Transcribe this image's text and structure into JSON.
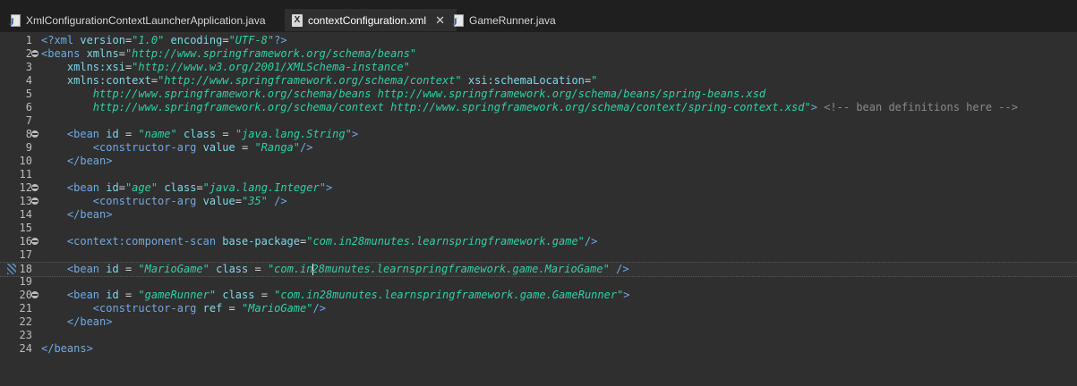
{
  "tabs": [
    {
      "label": "XmlConfigurationContextLauncherApplication.java",
      "icon": "java-file-icon",
      "active": false
    },
    {
      "label": "contextConfiguration.xml",
      "icon": "xml-file-icon",
      "active": true
    },
    {
      "label": "GameRunner.java",
      "icon": "java-file-icon",
      "active": false
    }
  ],
  "editor": {
    "line_numbers": [
      "1",
      "2",
      "3",
      "4",
      "5",
      "6",
      "7",
      "8",
      "9",
      "10",
      "11",
      "12",
      "13",
      "14",
      "15",
      "16",
      "17",
      "18",
      "19",
      "20",
      "21",
      "22",
      "23",
      "24"
    ],
    "lines": [
      {
        "parts": [
          {
            "t": "pi",
            "v": "<?xml "
          },
          {
            "t": "attr",
            "v": "version"
          },
          {
            "t": "plain",
            "v": "="
          },
          {
            "t": "val",
            "v": "\"1.0\""
          },
          {
            "t": "plain",
            "v": " "
          },
          {
            "t": "attr",
            "v": "encoding"
          },
          {
            "t": "plain",
            "v": "="
          },
          {
            "t": "val",
            "v": "\"UTF-8\""
          },
          {
            "t": "pi",
            "v": "?>"
          }
        ]
      },
      {
        "parts": [
          {
            "t": "tag",
            "v": "<beans "
          },
          {
            "t": "attr",
            "v": "xmlns"
          },
          {
            "t": "plain",
            "v": "="
          },
          {
            "t": "val",
            "v": "\"http://www.springframework.org/schema/beans\""
          }
        ]
      },
      {
        "parts": [
          {
            "t": "plain",
            "v": "    "
          },
          {
            "t": "attr",
            "v": "xmlns:xsi"
          },
          {
            "t": "plain",
            "v": "="
          },
          {
            "t": "val",
            "v": "\"http://www.w3.org/2001/XMLSchema-instance\""
          }
        ]
      },
      {
        "parts": [
          {
            "t": "plain",
            "v": "    "
          },
          {
            "t": "attr",
            "v": "xmlns:context"
          },
          {
            "t": "plain",
            "v": "="
          },
          {
            "t": "val",
            "v": "\"http://www.springframework.org/schema/context\""
          },
          {
            "t": "plain",
            "v": " "
          },
          {
            "t": "attr",
            "v": "xsi:schemaLocation"
          },
          {
            "t": "plain",
            "v": "="
          },
          {
            "t": "val",
            "v": "\""
          }
        ]
      },
      {
        "parts": [
          {
            "t": "val",
            "v": "        http://www.springframework.org/schema/beans http://www.springframework.org/schema/beans/spring-beans.xsd"
          }
        ]
      },
      {
        "parts": [
          {
            "t": "val",
            "v": "        http://www.springframework.org/schema/context http://www.springframework.org/schema/context/spring-context.xsd\""
          },
          {
            "t": "tag",
            "v": ">"
          },
          {
            "t": "plain",
            "v": " "
          },
          {
            "t": "cmt",
            "v": "<!-- bean definitions here -->"
          }
        ]
      },
      {
        "parts": []
      },
      {
        "parts": [
          {
            "t": "plain",
            "v": "    "
          },
          {
            "t": "tag",
            "v": "<bean "
          },
          {
            "t": "attr",
            "v": "id"
          },
          {
            "t": "plain",
            "v": " = "
          },
          {
            "t": "val",
            "v": "\"name\""
          },
          {
            "t": "plain",
            "v": " "
          },
          {
            "t": "attr",
            "v": "class"
          },
          {
            "t": "plain",
            "v": " = "
          },
          {
            "t": "val",
            "v": "\"java.lang.String\""
          },
          {
            "t": "tag",
            "v": ">"
          }
        ]
      },
      {
        "parts": [
          {
            "t": "plain",
            "v": "        "
          },
          {
            "t": "tag",
            "v": "<constructor-arg "
          },
          {
            "t": "attr",
            "v": "value"
          },
          {
            "t": "plain",
            "v": " = "
          },
          {
            "t": "val",
            "v": "\"Ranga\""
          },
          {
            "t": "tag",
            "v": "/>"
          }
        ]
      },
      {
        "parts": [
          {
            "t": "plain",
            "v": "    "
          },
          {
            "t": "tag",
            "v": "</bean>"
          }
        ]
      },
      {
        "parts": []
      },
      {
        "parts": [
          {
            "t": "plain",
            "v": "    "
          },
          {
            "t": "tag",
            "v": "<bean "
          },
          {
            "t": "attr",
            "v": "id"
          },
          {
            "t": "plain",
            "v": "="
          },
          {
            "t": "val",
            "v": "\"age\""
          },
          {
            "t": "plain",
            "v": " "
          },
          {
            "t": "attr",
            "v": "class"
          },
          {
            "t": "plain",
            "v": "="
          },
          {
            "t": "val",
            "v": "\"java.lang.Integer\""
          },
          {
            "t": "tag",
            "v": ">"
          }
        ]
      },
      {
        "parts": [
          {
            "t": "plain",
            "v": "        "
          },
          {
            "t": "tag",
            "v": "<constructor-arg "
          },
          {
            "t": "attr",
            "v": "value"
          },
          {
            "t": "plain",
            "v": "="
          },
          {
            "t": "val",
            "v": "\"35\""
          },
          {
            "t": "plain",
            "v": " "
          },
          {
            "t": "tag",
            "v": "/>"
          }
        ]
      },
      {
        "parts": [
          {
            "t": "plain",
            "v": "    "
          },
          {
            "t": "tag",
            "v": "</bean>"
          }
        ]
      },
      {
        "parts": []
      },
      {
        "parts": [
          {
            "t": "plain",
            "v": "    "
          },
          {
            "t": "tag",
            "v": "<context:component-scan "
          },
          {
            "t": "attr",
            "v": "base-package"
          },
          {
            "t": "plain",
            "v": "="
          },
          {
            "t": "val",
            "v": "\"com.in28munutes.learnspringframework.game\""
          },
          {
            "t": "tag",
            "v": "/>"
          }
        ]
      },
      {
        "parts": []
      },
      {
        "parts": [
          {
            "t": "plain",
            "v": "    "
          },
          {
            "t": "tag",
            "v": "<bean "
          },
          {
            "t": "attr",
            "v": "id"
          },
          {
            "t": "plain",
            "v": " = "
          },
          {
            "t": "val",
            "v": "\"MarioGame\""
          },
          {
            "t": "plain",
            "v": " "
          },
          {
            "t": "attr",
            "v": "class"
          },
          {
            "t": "plain",
            "v": " = "
          },
          {
            "t": "val",
            "v": "\"com.in"
          },
          {
            "t": "caret",
            "v": ""
          },
          {
            "t": "val",
            "v": "28munutes.learnspringframework.game.MarioGame\""
          },
          {
            "t": "plain",
            "v": " "
          },
          {
            "t": "tag",
            "v": "/>"
          }
        ]
      },
      {
        "parts": []
      },
      {
        "parts": [
          {
            "t": "plain",
            "v": "    "
          },
          {
            "t": "tag",
            "v": "<bean "
          },
          {
            "t": "attr",
            "v": "id"
          },
          {
            "t": "plain",
            "v": " = "
          },
          {
            "t": "val",
            "v": "\"gameRunner\""
          },
          {
            "t": "plain",
            "v": " "
          },
          {
            "t": "attr",
            "v": "class"
          },
          {
            "t": "plain",
            "v": " = "
          },
          {
            "t": "val",
            "v": "\"com.in28munutes.learnspringframework.game.GameRunner\""
          },
          {
            "t": "tag",
            "v": ">"
          }
        ]
      },
      {
        "parts": [
          {
            "t": "plain",
            "v": "        "
          },
          {
            "t": "tag",
            "v": "<constructor-arg "
          },
          {
            "t": "attr",
            "v": "ref"
          },
          {
            "t": "plain",
            "v": " = "
          },
          {
            "t": "val",
            "v": "\"MarioGame\""
          },
          {
            "t": "tag",
            "v": "/>"
          }
        ]
      },
      {
        "parts": [
          {
            "t": "plain",
            "v": "    "
          },
          {
            "t": "tag",
            "v": "</bean>"
          }
        ]
      },
      {
        "parts": []
      },
      {
        "parts": [
          {
            "t": "tag",
            "v": "</beans>"
          }
        ]
      }
    ],
    "fold_lines": [
      2,
      8,
      12,
      13,
      16,
      20
    ],
    "current_line": 18
  }
}
